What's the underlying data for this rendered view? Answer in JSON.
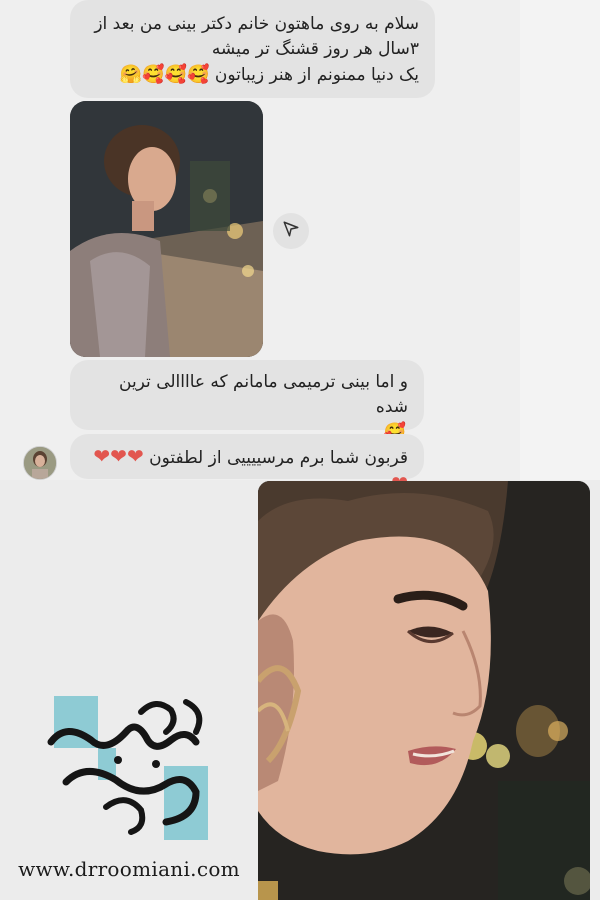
{
  "messages": [
    {
      "lines": [
        "سلام به روی ماهتون خانم دکتر بینی من بعد از",
        "۳سال هر روز قشنگ تر میشه",
        "یک دنیا ممنونم از هنر زیباتون"
      ],
      "emoji": "🥰🥰🥰🤗"
    },
    {
      "lines": [
        "و اما بینی ترمیمی مامانم که عاااالی ترین شده"
      ],
      "emoji": "🥰"
    },
    {
      "text": "قربون شما برم مرسییییی از لطفتون",
      "hearts": "❤❤❤❤"
    }
  ],
  "share_icon": "send-arrow-icon",
  "avatar_icon": "avatar-icon",
  "website": "www.drroomiani.com",
  "colors": {
    "bubble": "#e3e3e3",
    "background": "#ececec",
    "logo_square": "#8ecbd4",
    "heart": "#e2564f"
  }
}
